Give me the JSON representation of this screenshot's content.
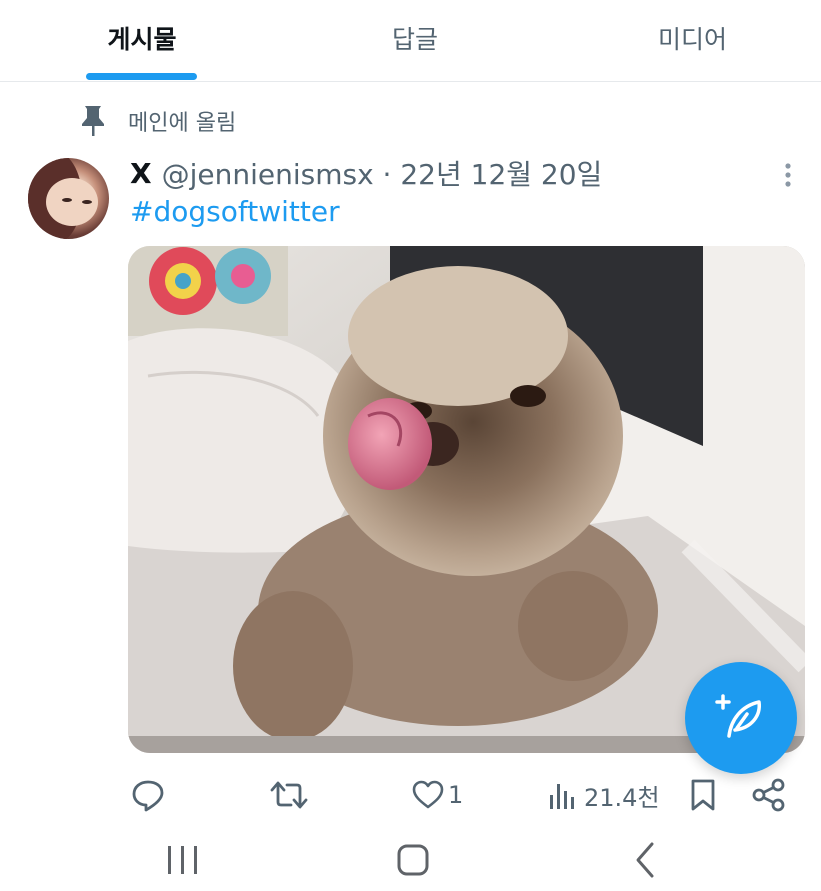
{
  "tabs": [
    {
      "label": "게시물",
      "active": true
    },
    {
      "label": "답글",
      "active": false
    },
    {
      "label": "미디어",
      "active": false
    }
  ],
  "pinned": {
    "label": "메인에 올림",
    "icon": "pin-icon"
  },
  "tweet": {
    "author_name": "X",
    "handle_date": "@jennienismsx · 22년 12월 20일",
    "text": "#dogsoftwitter",
    "media_description_icon": "dog-photo",
    "actions": {
      "reply_count": "",
      "retweet_count": "",
      "like_count": "1",
      "views_count": "21.4천"
    }
  },
  "fab": {
    "icon": "compose-icon"
  },
  "colors": {
    "accent": "#1d9bf0",
    "text_primary": "#0f1419",
    "text_secondary": "#536471"
  },
  "system_nav": {
    "icons": [
      "recent-apps-icon",
      "home-icon",
      "back-icon"
    ]
  }
}
